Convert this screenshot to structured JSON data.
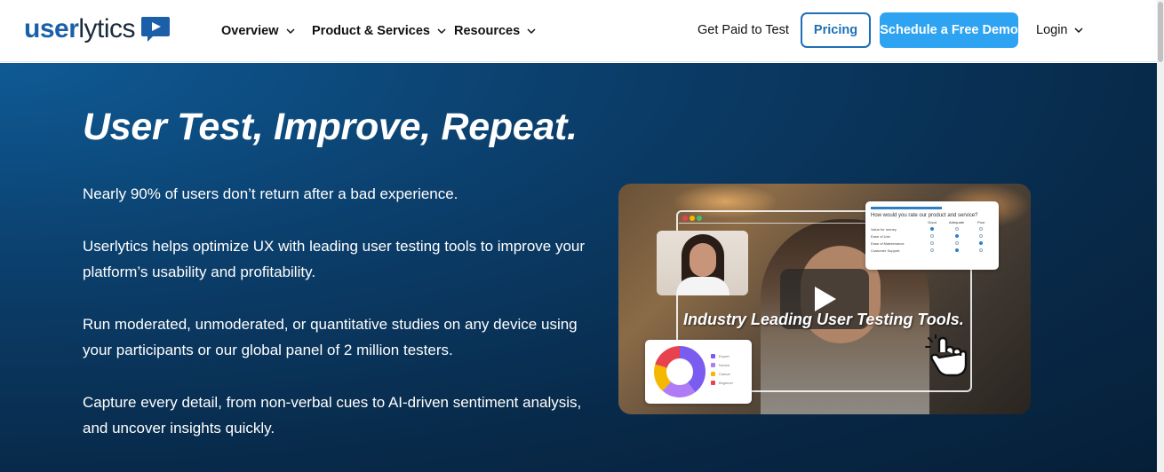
{
  "header": {
    "logo_user": "user",
    "logo_lytics": "lytics",
    "nav": [
      {
        "label": "Overview"
      },
      {
        "label": "Product & Services"
      },
      {
        "label": "Resources"
      }
    ],
    "paid_label": "Get Paid to Test",
    "pricing_label": "Pricing",
    "demo_label": "Schedule a Free Demo",
    "login_label": "Login"
  },
  "hero": {
    "title": "User Test, Improve, Repeat.",
    "paragraphs": [
      "Nearly 90% of users don’t return after a bad experience.",
      "Userlytics helps optimize UX with leading user testing tools to improve your platform’s usability and profitability.",
      "Run moderated, unmoderated, or quantitative studies on any device using your participants or our global panel of 2 million testers.",
      "Capture every detail, from non-verbal cues to AI-driven sentiment analysis, and uncover insights quickly."
    ]
  },
  "video": {
    "caption": "Industry Leading User Testing Tools.",
    "survey": {
      "question": "How would you rate our product and service?",
      "columns": [
        "Good",
        "Adequate",
        "Poor"
      ],
      "rows": [
        {
          "label": "Value for money",
          "selected": 0
        },
        {
          "label": "Ease of Use",
          "selected": 1
        },
        {
          "label": "Ease of Maintenance",
          "selected": 2
        },
        {
          "label": "Customer Support",
          "selected": 1
        }
      ]
    },
    "legend": [
      {
        "label": "Expert",
        "color": "#7b5cf0"
      },
      {
        "label": "Novice",
        "color": "#b07cf5"
      },
      {
        "label": "Casual",
        "color": "#f5b800"
      },
      {
        "label": "Beginner",
        "color": "#e8424e"
      }
    ]
  },
  "colors": {
    "brand_blue": "#1a5fa8",
    "demo_button": "#2ea3f2",
    "pricing_border": "#1e6fb5",
    "hero_dark": "#082a4a"
  }
}
